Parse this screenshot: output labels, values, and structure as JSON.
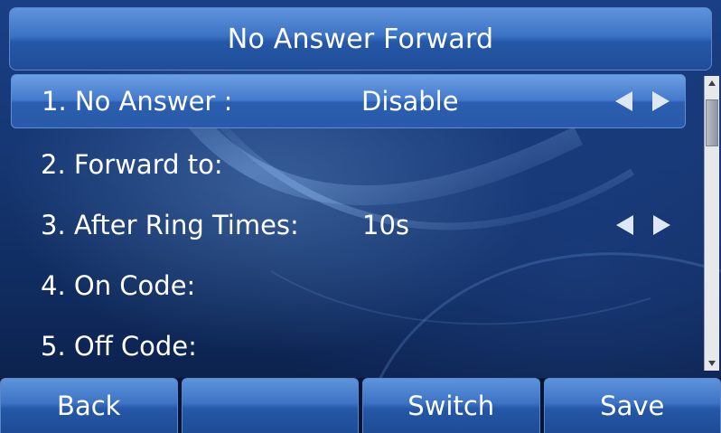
{
  "header": {
    "title": "No Answer Forward"
  },
  "menu": {
    "items": [
      {
        "label": "1. No Answer :",
        "value": "Disable",
        "has_arrows": true,
        "selected": true
      },
      {
        "label": "2. Forward to:",
        "value": "",
        "has_arrows": false,
        "selected": false
      },
      {
        "label": "3. After Ring Times:",
        "value": "10s",
        "has_arrows": true,
        "selected": false
      },
      {
        "label": "4. On Code:",
        "value": "",
        "has_arrows": false,
        "selected": false
      },
      {
        "label": "5. Off Code:",
        "value": "",
        "has_arrows": false,
        "selected": false
      }
    ]
  },
  "icons": {
    "left": "arrow-left-icon",
    "right": "arrow-right-icon",
    "scroll_up": "scroll-up-icon",
    "scroll_down": "scroll-down-icon"
  },
  "softkeys": {
    "key1": "Back",
    "key2": "",
    "key3": "Switch",
    "key4": "Save"
  },
  "colors": {
    "background": "#163773",
    "bar": "#3d73c4",
    "text": "#ffffff",
    "arrow": "#dde7f5"
  }
}
